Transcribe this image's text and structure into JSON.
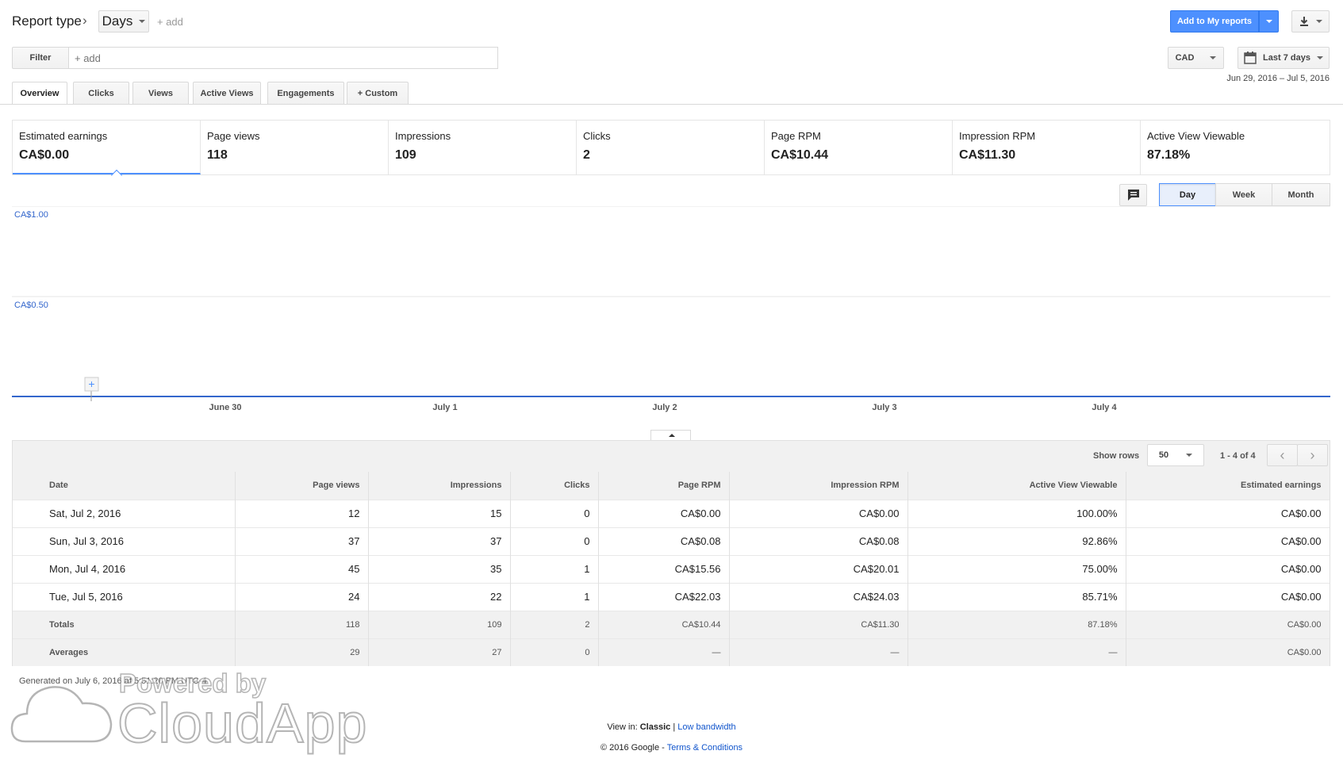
{
  "header": {
    "report_type": "Report type",
    "dimension": "Days",
    "add_label": "+ add",
    "add_to_reports": "Add to My reports"
  },
  "filter": {
    "label": "Filter",
    "placeholder": "+ add"
  },
  "currency": "CAD",
  "date_range": {
    "label": "Last 7 days",
    "range_text": "Jun 29, 2016 – Jul 5, 2016"
  },
  "tabs": [
    {
      "label": "Overview",
      "active": true
    },
    {
      "label": "Clicks"
    },
    {
      "label": "Views"
    },
    {
      "label": "Active Views"
    },
    {
      "label": "Engagements"
    },
    {
      "label": "+  Custom"
    }
  ],
  "metrics": [
    {
      "label": "Estimated earnings",
      "value": "CA$0.00",
      "selected": true
    },
    {
      "label": "Page views",
      "value": "118"
    },
    {
      "label": "Impressions",
      "value": "109"
    },
    {
      "label": "Clicks",
      "value": "2"
    },
    {
      "label": "Page RPM",
      "value": "CA$10.44"
    },
    {
      "label": "Impression RPM",
      "value": "CA$11.30"
    },
    {
      "label": "Active View Viewable",
      "value": "87.18%"
    }
  ],
  "granularity": {
    "options": [
      "Day",
      "Week",
      "Month"
    ],
    "selected": "Day"
  },
  "chart_data": {
    "type": "line",
    "title": "",
    "xlabel": "",
    "ylabel": "",
    "x_tick_labels": [
      "June 30",
      "July 1",
      "July 2",
      "July 3",
      "July 4"
    ],
    "y_tick_labels": [
      "CA$1.00",
      "CA$0.50"
    ],
    "ylim": [
      0,
      1
    ],
    "grid": true,
    "series": [
      {
        "name": "Estimated earnings",
        "color": "#3366cc",
        "x": [
          "Jun 29, 2016",
          "Jun 30, 2016",
          "Jul 1, 2016",
          "Jul 2, 2016",
          "Jul 3, 2016",
          "Jul 4, 2016",
          "Jul 5, 2016"
        ],
        "values": [
          0,
          0,
          0,
          0,
          0,
          0,
          0
        ]
      }
    ]
  },
  "table": {
    "show_rows_label": "Show rows",
    "rows_per_page": "50",
    "pagination": "1 - 4 of 4",
    "columns": [
      "Date",
      "Page views",
      "Impressions",
      "Clicks",
      "Page RPM",
      "Impression RPM",
      "Active View Viewable",
      "Estimated earnings"
    ],
    "rows": [
      [
        "Sat, Jul 2, 2016",
        "12",
        "15",
        "0",
        "CA$0.00",
        "CA$0.00",
        "100.00%",
        "CA$0.00"
      ],
      [
        "Sun, Jul 3, 2016",
        "37",
        "37",
        "0",
        "CA$0.08",
        "CA$0.08",
        "92.86%",
        "CA$0.00"
      ],
      [
        "Mon, Jul 4, 2016",
        "45",
        "35",
        "1",
        "CA$15.56",
        "CA$20.01",
        "75.00%",
        "CA$0.00"
      ],
      [
        "Tue, Jul 5, 2016",
        "24",
        "22",
        "1",
        "CA$22.03",
        "CA$24.03",
        "85.71%",
        "CA$0.00"
      ]
    ],
    "totals": [
      "Totals",
      "118",
      "109",
      "2",
      "CA$10.44",
      "CA$11.30",
      "87.18%",
      "CA$0.00"
    ],
    "averages": [
      "Averages",
      "29",
      "27",
      "0",
      "—",
      "—",
      "—",
      "CA$0.00"
    ]
  },
  "footer": {
    "generated": "Generated on July 6, 2016 at 5:51:20 PM UTC-4",
    "view_in_prefix": "View in:",
    "view_in_current": "Classic",
    "view_in_sep": "|",
    "low_bandwidth": "Low bandwidth",
    "copyright": "© 2016 Google -",
    "terms": "Terms & Conditions"
  },
  "watermark": {
    "line1": "Powered by",
    "line2": "CloudApp"
  },
  "colors": {
    "accent": "#4d90fe",
    "chart_line": "#3366cc",
    "link": "#1155cc"
  }
}
